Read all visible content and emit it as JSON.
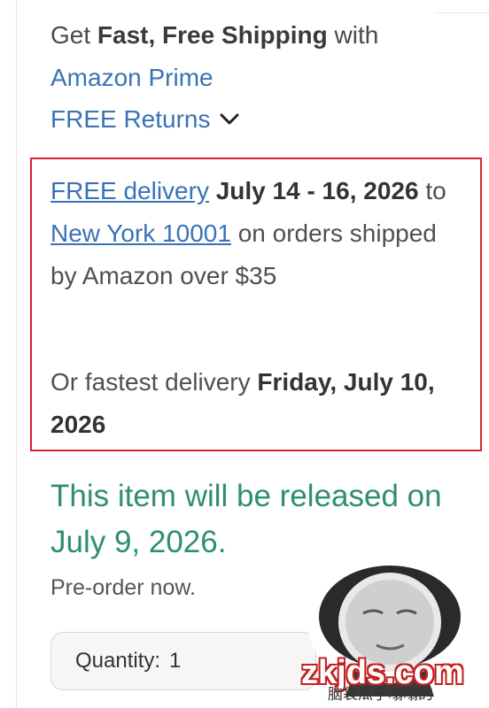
{
  "shipping": {
    "prefix": "Get ",
    "bold": "Fast, Free Shipping",
    "suffix": " with",
    "prime_link": "Amazon Prime",
    "returns_label": "FREE Returns"
  },
  "delivery": {
    "free_link": "FREE delivery",
    "dates": "July 14 - 16, 2026",
    "to": "to",
    "location_link": "New York 10001",
    "condition": "on orders shipped by Amazon over $35",
    "fastest_prefix": "Or fastest delivery",
    "fastest_date": "Friday, July 10, 2026"
  },
  "release": {
    "message": "This item will be released on July 9, 2026.",
    "preorder": "Pre-order now."
  },
  "quantity": {
    "label": "Quantity:",
    "value": "1"
  },
  "watermark": {
    "text": "zkjds.com",
    "sub": "脑袋瓜子嗡嗡的"
  },
  "colors": {
    "link": "#3a72b6",
    "release_green": "#2f8f6b",
    "highlight_border": "#d6262c"
  },
  "icons": {
    "returns_toggle": "chevron-down-icon"
  }
}
